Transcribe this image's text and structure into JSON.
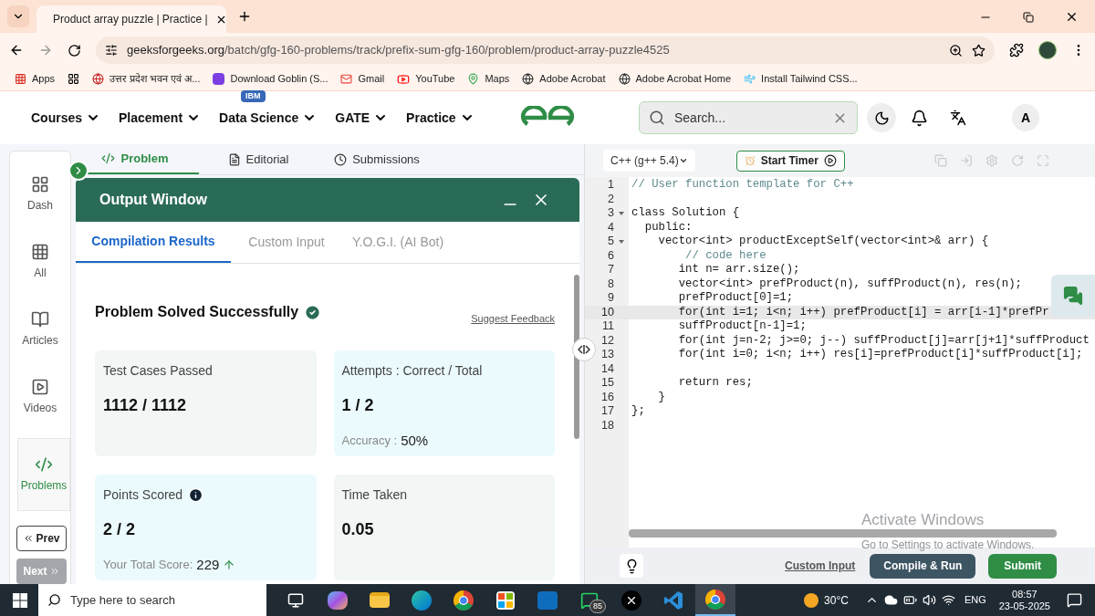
{
  "browser": {
    "tabs": [
      {
        "title": "Product array puzzle | Practice |",
        "selected": true
      }
    ],
    "url_host": "geeksforgeeks.org",
    "url_path": "/batch/gfg-160-problems/track/prefix-sum-gfg-160/problem/product-array-puzzle4525",
    "bookmarks": [
      {
        "label": "Apps",
        "kind": "apps"
      },
      {
        "label": "उत्तर प्रदेश भवन एवं अ...",
        "kind": "site"
      },
      {
        "label": "Download Goblin (S...",
        "kind": "goblin"
      },
      {
        "label": "Gmail",
        "kind": "gmail"
      },
      {
        "label": "YouTube",
        "kind": "youtube"
      },
      {
        "label": "Maps",
        "kind": "maps"
      },
      {
        "label": "Adobe Acrobat",
        "kind": "web"
      },
      {
        "label": "Adobe Acrobat Home",
        "kind": "web"
      },
      {
        "label": "Install Tailwind CSS...",
        "kind": "tailwind"
      }
    ]
  },
  "site_nav": {
    "items": [
      {
        "label": "Courses"
      },
      {
        "label": "Placement"
      },
      {
        "label": "Data Science",
        "badge": "IBM"
      },
      {
        "label": "GATE"
      },
      {
        "label": "Practice"
      }
    ],
    "search_placeholder": "Search...",
    "avatar": "A"
  },
  "sidebar": {
    "items": [
      {
        "label": "Dash",
        "kind": "dash",
        "selected": false
      },
      {
        "label": "All",
        "kind": "all",
        "selected": false
      },
      {
        "label": "Articles",
        "kind": "articles",
        "selected": false
      },
      {
        "label": "Videos",
        "kind": "videos",
        "selected": false
      },
      {
        "label": "Problems",
        "kind": "problems",
        "selected": true
      }
    ],
    "prev": {
      "label": "Prev",
      "disabled": false
    },
    "next": {
      "label": "Next",
      "disabled": true
    }
  },
  "problem_tabs": [
    {
      "label": "Problem",
      "kind": "code",
      "selected": true
    },
    {
      "label": "Editorial",
      "kind": "doc",
      "selected": false
    },
    {
      "label": "Submissions",
      "kind": "clock",
      "selected": false
    }
  ],
  "output_window": {
    "title": "Output Window",
    "tabs": [
      {
        "label": "Compilation Results",
        "selected": true
      },
      {
        "label": "Custom Input",
        "selected": false
      },
      {
        "label": "Y.O.G.I. (AI Bot)",
        "selected": false
      }
    ],
    "status": "Problem Solved Successfully",
    "feedback_link": "Suggest Feedback",
    "cards": [
      {
        "title": "Test Cases Passed",
        "value": "1112 / 1112",
        "color": "#f2f6f5"
      },
      {
        "title": "Attempts : Correct / Total",
        "value": "1 / 2",
        "note_label": "Accuracy :",
        "note_value": "50%",
        "color": "#ebfafd"
      },
      {
        "title": "Points Scored",
        "value": "2 / 2",
        "info": true,
        "note_label": "Your Total Score:",
        "note_value": "229",
        "trend_up": true,
        "color": "#ebfafd"
      },
      {
        "title": "Time Taken",
        "value": "0.05",
        "color": "#f2f6f5"
      }
    ]
  },
  "editor": {
    "language": "C++ (g++ 5.4)",
    "timer_button": "Start Timer",
    "lines": [
      {
        "n": "1",
        "text": "// User function template for C++",
        "kind": "comment",
        "foldable": false,
        "selected": false
      },
      {
        "n": "2",
        "foldable": false,
        "selected": false
      },
      {
        "n": "3",
        "text": "class Solution {",
        "kind": "code",
        "foldable": true,
        "selected": false
      },
      {
        "n": "4",
        "text": "  public:",
        "kind": "code",
        "foldable": false,
        "selected": false
      },
      {
        "n": "5",
        "text": "    vector<int> productExceptSelf(vector<int>& arr) {",
        "kind": "code",
        "foldable": true,
        "selected": false
      },
      {
        "n": "6",
        "text": "        // code here",
        "kind": "comment",
        "foldable": false,
        "selected": false
      },
      {
        "n": "7",
        "text": "       int n= arr.size();",
        "kind": "code",
        "foldable": false,
        "selected": false
      },
      {
        "n": "8",
        "text": "       vector<int> prefProduct(n), suffProduct(n), res(n);",
        "kind": "code",
        "foldable": false,
        "selected": false
      },
      {
        "n": "9",
        "text": "       prefProduct[0]=1;",
        "kind": "code",
        "foldable": false,
        "selected": false
      },
      {
        "n": "10",
        "text": "       for(int i=1; i<n; i++) prefProduct[i] = arr[i-1]*prefPr",
        "kind": "code",
        "foldable": false,
        "selected": true
      },
      {
        "n": "11",
        "text": "       suffProduct[n-1]=1;",
        "kind": "code",
        "foldable": false,
        "selected": false
      },
      {
        "n": "12",
        "text": "       for(int j=n-2; j>=0; j--) suffProduct[j]=arr[j+1]*suffProduct",
        "kind": "code",
        "foldable": false,
        "selected": false
      },
      {
        "n": "13",
        "text": "       for(int i=0; i<n; i++) res[i]=prefProduct[i]*suffProduct[i];",
        "kind": "code",
        "foldable": false,
        "selected": false
      },
      {
        "n": "14",
        "foldable": false,
        "selected": false
      },
      {
        "n": "15",
        "text": "       return res;",
        "kind": "code",
        "foldable": false,
        "selected": false
      },
      {
        "n": "16",
        "text": "    }",
        "kind": "code",
        "foldable": false,
        "selected": false
      },
      {
        "n": "17",
        "text": "};",
        "kind": "code",
        "foldable": false,
        "selected": false
      },
      {
        "n": "18",
        "foldable": false,
        "selected": false
      }
    ],
    "custom_input_link": "Custom Input",
    "compile_button": "Compile & Run",
    "submit_button": "Submit"
  },
  "os_notice": {
    "title": "Activate Windows",
    "text": "Go to Settings to activate Windows."
  },
  "taskbar": {
    "search_placeholder": "Type here to search",
    "apps": [
      {
        "kind": "taskview",
        "selected": false
      },
      {
        "kind": "copilot",
        "selected": false
      },
      {
        "kind": "folder",
        "selected": false
      },
      {
        "kind": "edge",
        "selected": false
      },
      {
        "kind": "chrome",
        "selected": false
      },
      {
        "kind": "store",
        "selected": false
      },
      {
        "kind": "outlook",
        "selected": false
      },
      {
        "kind": "whatsapp",
        "badge": "85",
        "selected": false
      },
      {
        "kind": "x",
        "selected": false
      },
      {
        "kind": "vscode",
        "selected": false
      },
      {
        "kind": "chrome",
        "selected": true
      }
    ],
    "temperature": "30°C",
    "language": "ENG",
    "time": "08:57",
    "date": "23-05-2025"
  }
}
